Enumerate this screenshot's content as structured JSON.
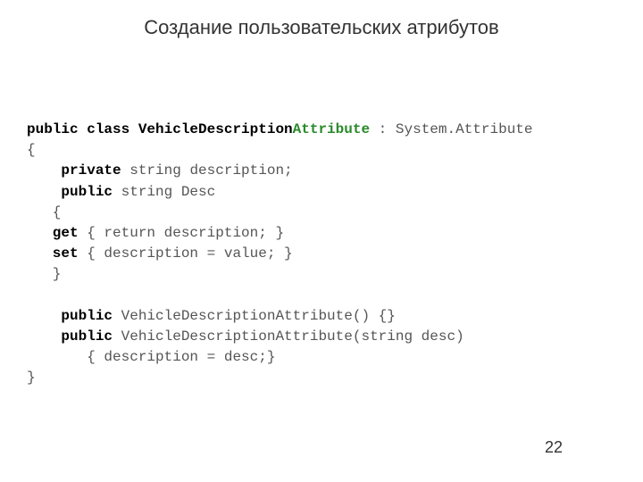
{
  "title": "Создание пользовательских атрибутов",
  "pageNumber": "22",
  "code": {
    "l1a": "public class VehicleDescription",
    "l1b": "Attribute",
    "l1c": " : System.Attribute",
    "l2": "{",
    "l3a": "    private",
    "l3b": " string description;",
    "l4a": "    public",
    "l4b": " string Desc",
    "l5": "   {",
    "l6a": "   get",
    "l6b": " { return description; }",
    "l7a": "   set",
    "l7b": " { description = value; }",
    "l8": "   }",
    "l9a": "    public",
    "l9b": " VehicleDescriptionAttribute() {}",
    "l10a": "    public",
    "l10b": " VehicleDescriptionAttribute(string desc)",
    "l11": "       { description = desc;}",
    "l12": "}"
  }
}
